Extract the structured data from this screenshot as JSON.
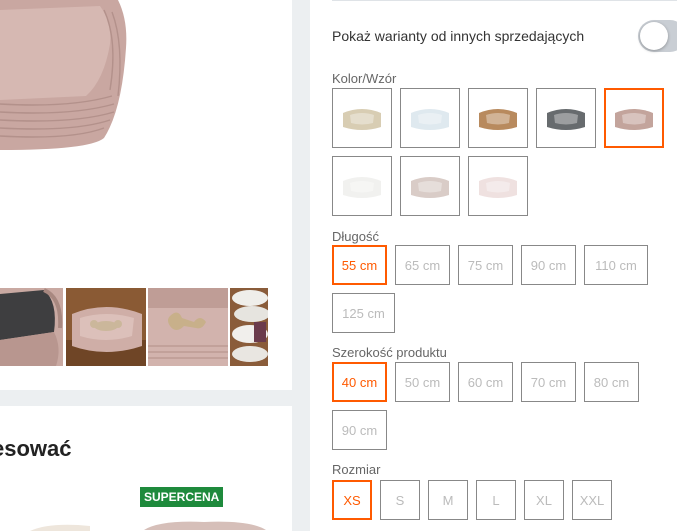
{
  "gallery": {
    "main_image": "pink-corduroy-dog-bed-photo",
    "thumbnails": [
      "dark-bed-photo",
      "bone-pillow-bed-photo",
      "bone-bed-closeup-photo",
      "rolled-beds-photo"
    ]
  },
  "recommendations": {
    "title": "esować",
    "badge": "SUPERCENA"
  },
  "variants_toggle": {
    "label": "Pokaż warianty od innych sprzedających",
    "enabled": false
  },
  "color": {
    "label": "Kolor/Wzór",
    "swatches": [
      {
        "name": "beige",
        "color": "#d8cdb3",
        "selected": false
      },
      {
        "name": "light-blue",
        "color": "#dfe9ef",
        "selected": false
      },
      {
        "name": "caramel",
        "color": "#b88a5e",
        "selected": false
      },
      {
        "name": "graphite",
        "color": "#676b6e",
        "selected": false
      },
      {
        "name": "dusty-pink",
        "color": "#c3a49c",
        "selected": true
      },
      {
        "name": "white",
        "color": "#f1f1ef",
        "selected": false
      },
      {
        "name": "light-pink-grey",
        "color": "#d9ccc7",
        "selected": false
      },
      {
        "name": "pale-pink",
        "color": "#efe1e0",
        "selected": false
      }
    ]
  },
  "length": {
    "label": "Długość",
    "options": [
      {
        "label": "55 cm",
        "selected": true
      },
      {
        "label": "65 cm",
        "selected": false
      },
      {
        "label": "75 cm",
        "selected": false
      },
      {
        "label": "90 cm",
        "selected": false
      },
      {
        "label": "110 cm",
        "selected": false
      },
      {
        "label": "125 cm",
        "selected": false
      }
    ]
  },
  "width": {
    "label": "Szerokość produktu",
    "options": [
      {
        "label": "40 cm",
        "selected": true
      },
      {
        "label": "50 cm",
        "selected": false
      },
      {
        "label": "60 cm",
        "selected": false
      },
      {
        "label": "70 cm",
        "selected": false
      },
      {
        "label": "80 cm",
        "selected": false
      },
      {
        "label": "90 cm",
        "selected": false
      }
    ]
  },
  "size": {
    "label": "Rozmiar",
    "options": [
      {
        "label": "XS",
        "selected": true
      },
      {
        "label": "S",
        "selected": false
      },
      {
        "label": "M",
        "selected": false
      },
      {
        "label": "L",
        "selected": false
      },
      {
        "label": "XL",
        "selected": false
      },
      {
        "label": "XXL",
        "selected": false
      }
    ]
  },
  "colors": {
    "accent": "#ff5a00",
    "badge": "#1e8a3c"
  }
}
